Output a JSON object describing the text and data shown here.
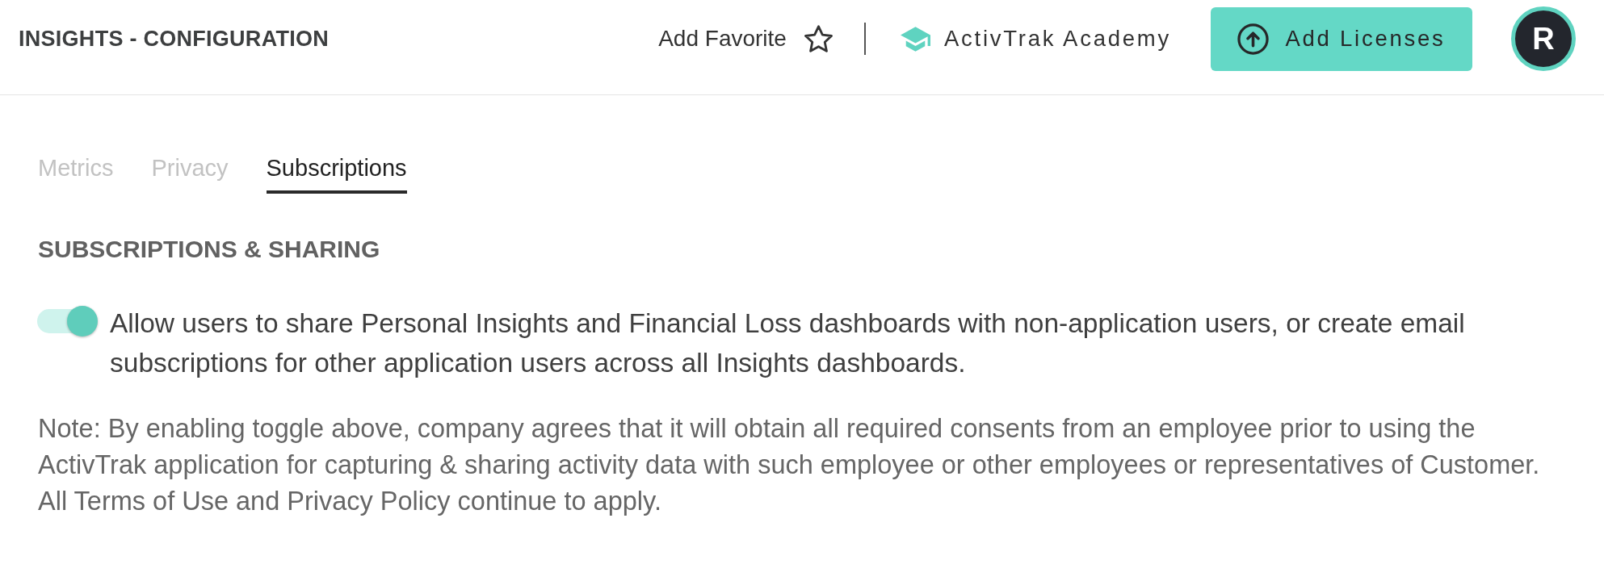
{
  "header": {
    "title": "INSIGHTS - CONFIGURATION",
    "favorite_label": "Add Favorite",
    "academy_label": "ActivTrak Academy",
    "add_licenses_label": "Add Licenses",
    "avatar_initial": "R"
  },
  "tabs": [
    {
      "label": "Metrics",
      "selected": false
    },
    {
      "label": "Privacy",
      "selected": false
    },
    {
      "label": "Subscriptions",
      "selected": true
    }
  ],
  "section": {
    "heading": "SUBSCRIPTIONS & SHARING",
    "toggle": {
      "on": true,
      "label": "Allow users to share Personal Insights and Financial Loss dashboards with non-application users, or create email subscriptions for other application users across all Insights dashboards."
    },
    "note": "Note: By enabling toggle above, company agrees that it will obtain all required consents from an employee prior to using the ActivTrak application for capturing & sharing activity data with such employee or other employees or representatives of Customer. All Terms of Use and Privacy Policy continue to apply."
  }
}
